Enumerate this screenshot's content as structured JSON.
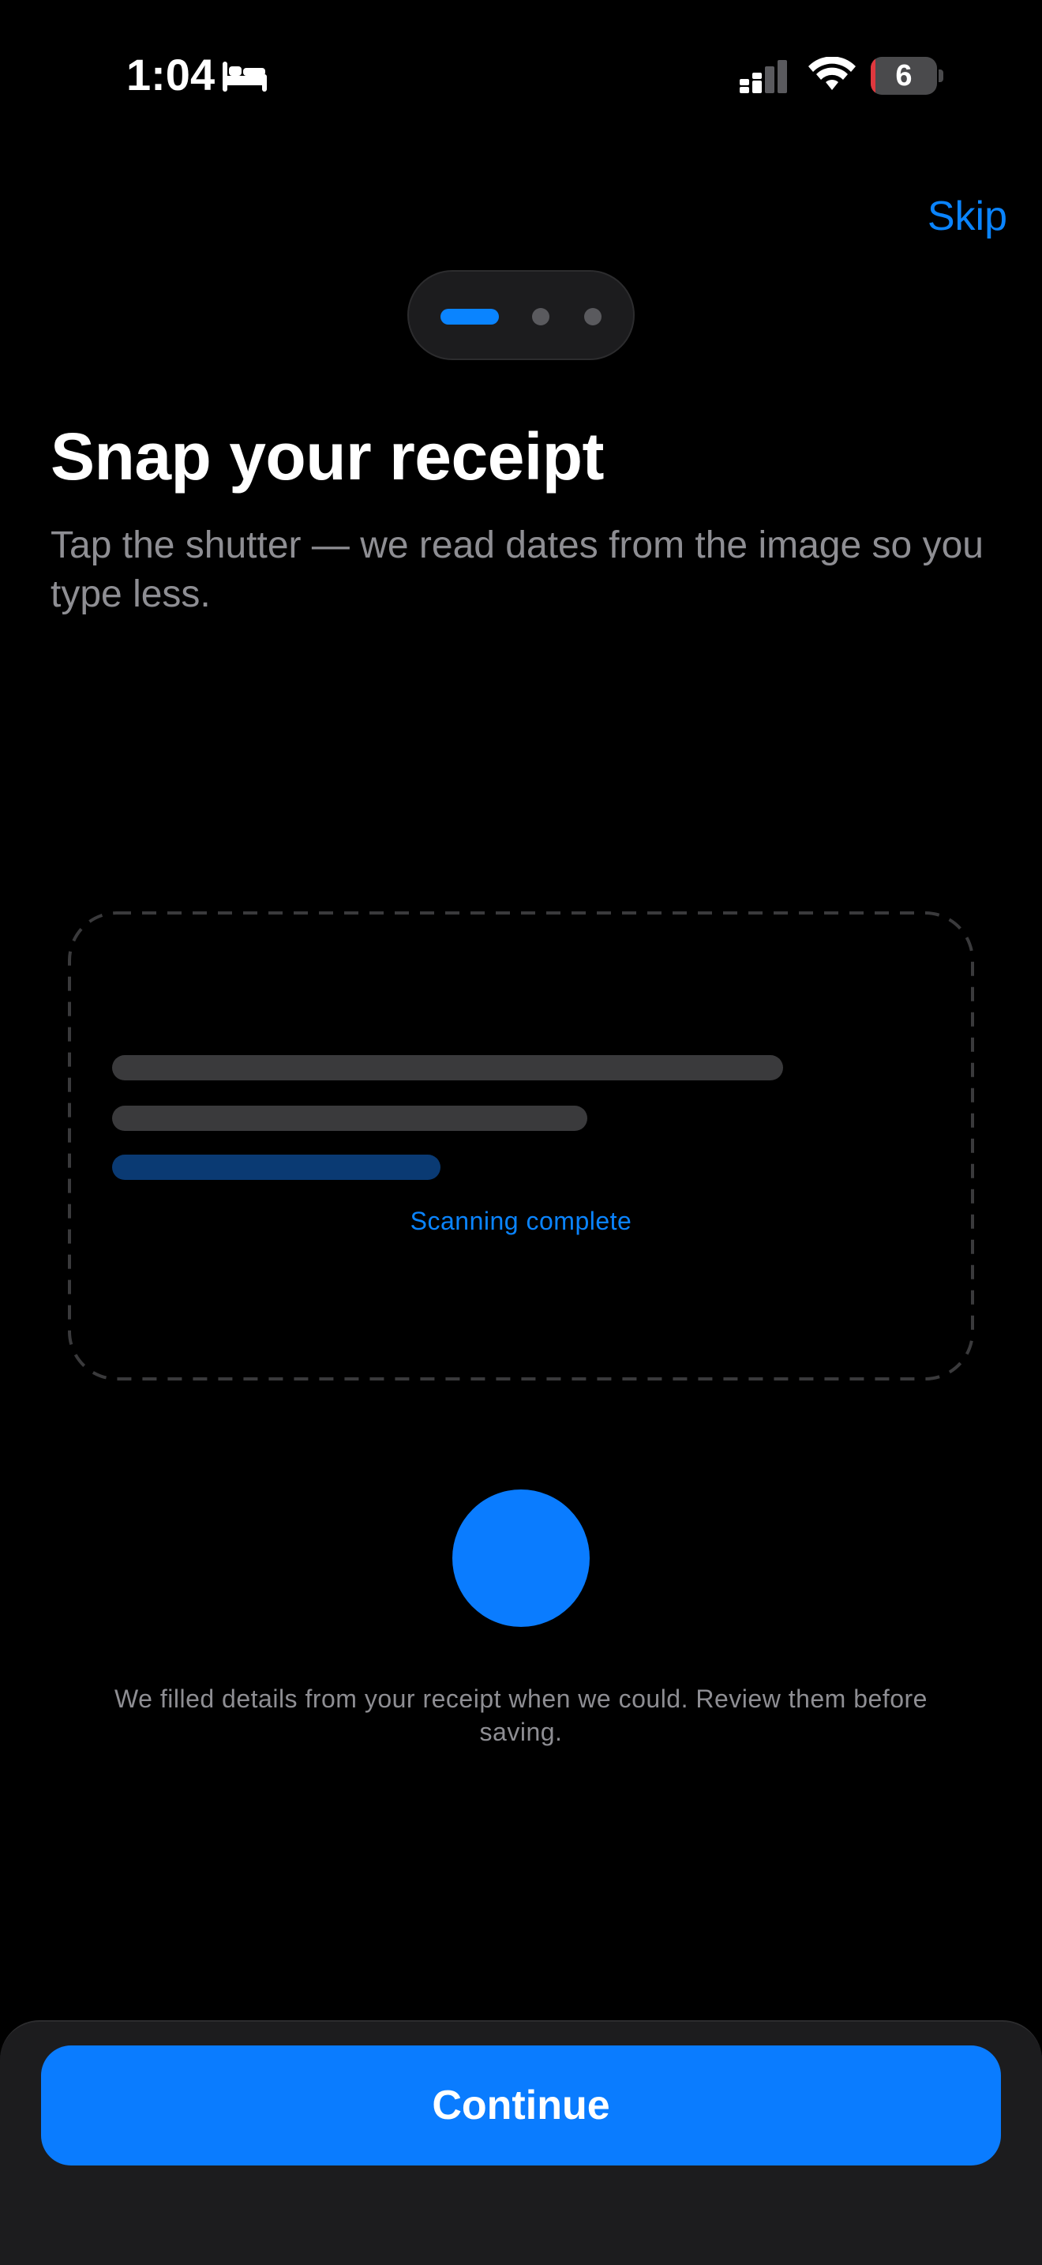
{
  "status_bar": {
    "time": "1:04",
    "focus_icon": "bed-icon",
    "signal_icon": "cellular-signal-icon",
    "wifi_icon": "wifi-icon",
    "battery_level": "6",
    "battery_fraction": 0.06
  },
  "header": {
    "skip_label": "Skip"
  },
  "pager": {
    "page_count": 3,
    "current_page": 1
  },
  "content": {
    "title": "Snap your receipt",
    "subtitle": "Tap the shutter — we read dates from the image so you type less."
  },
  "scan": {
    "status": "Scanning complete"
  },
  "shutter": {
    "icon": "shutter-button"
  },
  "note": "We filled details from your receipt when we could. Review them before saving.",
  "footer": {
    "continue_label": "Continue"
  },
  "colors": {
    "accent": "#0a84ff",
    "background": "#000000",
    "secondary_text": "#8e8e93",
    "sheet": "#1c1c1e"
  }
}
